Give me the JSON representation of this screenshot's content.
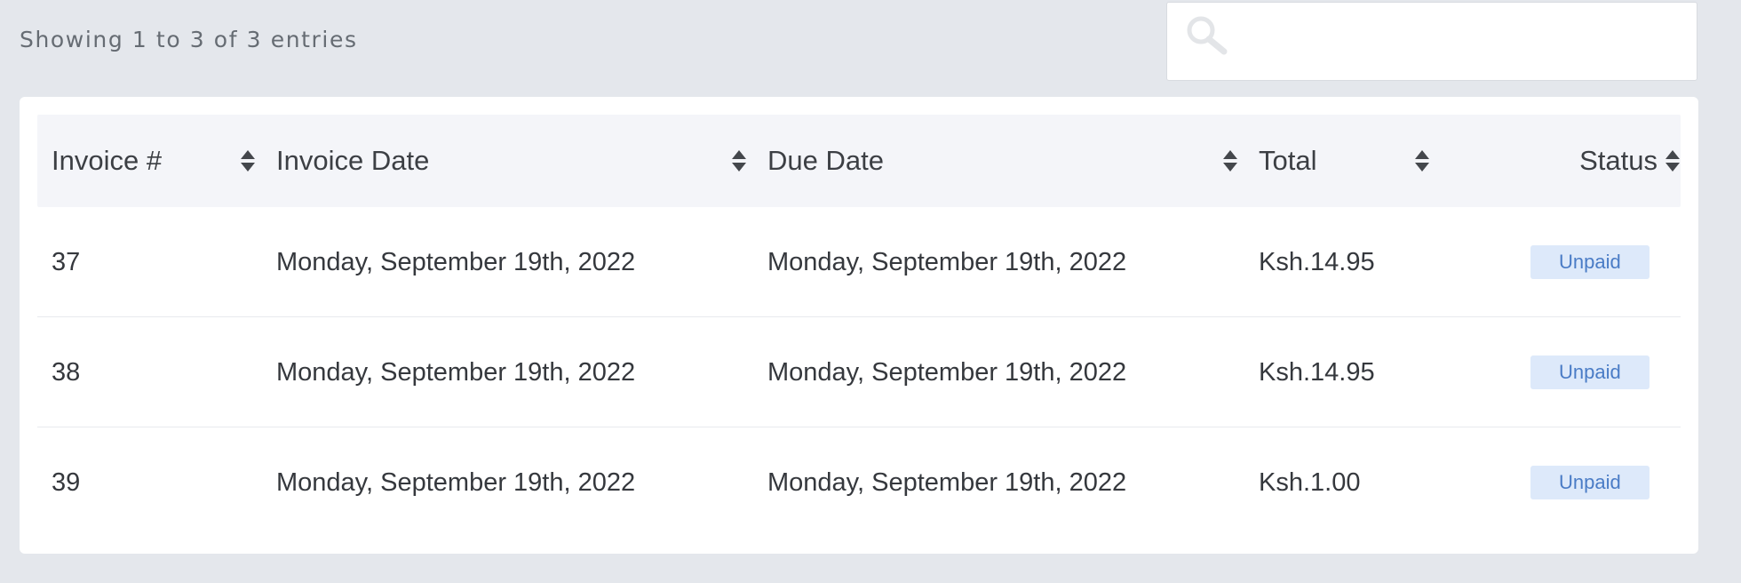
{
  "entries_info": "Showing 1 to 3 of 3 entries",
  "search": {
    "placeholder": "",
    "value": "",
    "icon": "search-icon"
  },
  "table": {
    "columns": [
      {
        "label": "Invoice #",
        "sort_icon": "sort-icon"
      },
      {
        "label": "Invoice Date",
        "sort_icon": "sort-icon"
      },
      {
        "label": "Due Date",
        "sort_icon": "sort-icon"
      },
      {
        "label": "Total",
        "sort_icon": "sort-icon"
      },
      {
        "label": "Status",
        "sort_icon": "sort-icon"
      }
    ],
    "rows": [
      {
        "invoice": "37",
        "invoice_date": "Monday, September 19th, 2022",
        "due_date": "Monday, September 19th, 2022",
        "total": "Ksh.14.95",
        "status": "Unpaid"
      },
      {
        "invoice": "38",
        "invoice_date": "Monday, September 19th, 2022",
        "due_date": "Monday, September 19th, 2022",
        "total": "Ksh.14.95",
        "status": "Unpaid"
      },
      {
        "invoice": "39",
        "invoice_date": "Monday, September 19th, 2022",
        "due_date": "Monday, September 19th, 2022",
        "total": "Ksh.1.00",
        "status": "Unpaid"
      }
    ]
  },
  "colors": {
    "page_background": "#e4e7ec",
    "header_background": "#f4f5f9",
    "badge_background": "#dde9fa",
    "badge_text": "#4a7cc6"
  }
}
